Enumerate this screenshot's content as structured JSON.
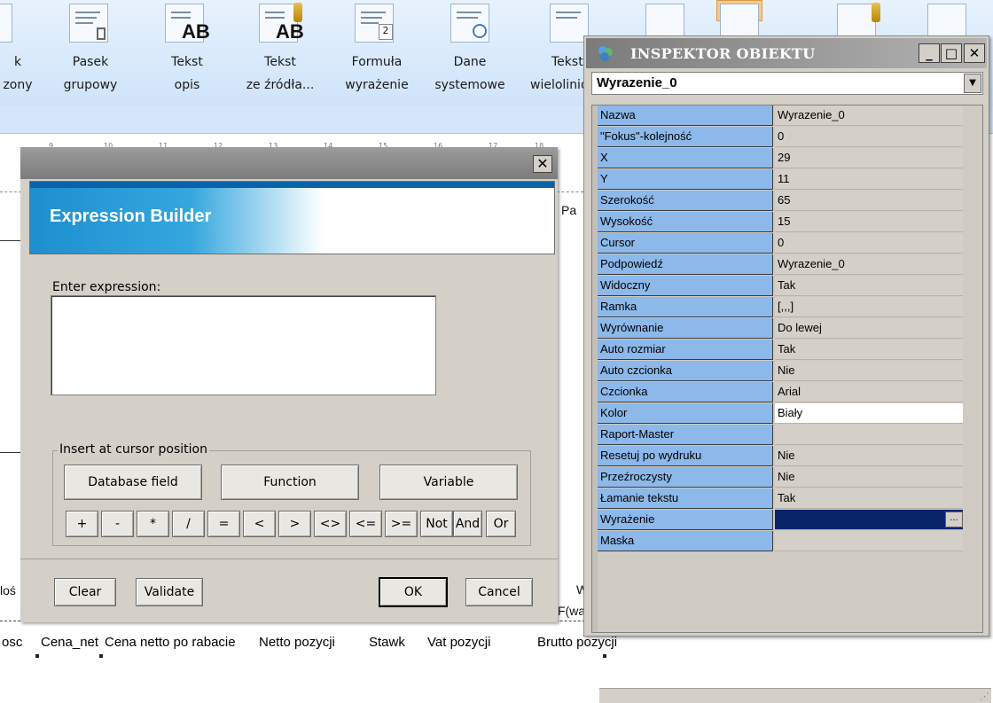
{
  "ribbon": {
    "items": [
      {
        "line1": "k",
        "line2": "zony"
      },
      {
        "line1": "Pasek",
        "line2": "grupowy"
      },
      {
        "line1": "Tekst",
        "line2": "opis"
      },
      {
        "line1": "Tekst",
        "line2": "ze źródła..."
      },
      {
        "line1": "Formuła",
        "line2": "wyrażenie"
      },
      {
        "line1": "Dane",
        "line2": "systemowe"
      },
      {
        "line1": "Tekst",
        "line2": "wielolinio"
      }
    ],
    "icon_text_ab": "AB",
    "icon_text_formula": "2"
  },
  "report": {
    "ruler": [
      "9",
      "10",
      "11",
      "12",
      "13",
      "14",
      "15",
      "16",
      "17",
      "18"
    ],
    "page_text": "Pa",
    "left_text": "loś",
    "w_text": "W",
    "fwa_text": "F(wa",
    "columns": [
      "osc",
      "Cena_net",
      "Cena netto po rabacie",
      "Netto pozycji",
      "Stawk",
      "Vat pozycji",
      "Brutto pozycji"
    ]
  },
  "expression_builder": {
    "close_glyph": "✕",
    "title": "Expression Builder",
    "enter_label": "Enter expression:",
    "expression_value": "",
    "insert_group_label": "Insert at cursor position",
    "database_field_label": "Database field",
    "function_label": "Function",
    "variable_label": "Variable",
    "operators": [
      "+",
      "-",
      "*",
      "/",
      "=",
      "<",
      ">",
      "<>",
      "<=",
      ">=",
      "Not",
      "And",
      "Or"
    ],
    "clear_label": "Clear",
    "validate_label": "Validate",
    "ok_label": "OK",
    "cancel_label": "Cancel"
  },
  "inspector": {
    "title": "INSPEKTOR OBIEKTU",
    "minimize_glyph": "_",
    "maximize_glyph": "□",
    "close_glyph": "✕",
    "selected_object": "Wyrazenie_0",
    "dropdown_glyph": "▼",
    "dots_label": "...",
    "properties": [
      {
        "key": "Nazwa",
        "value": "Wyrazenie_0"
      },
      {
        "key": "\"Fokus\"-kolejność",
        "value": "0"
      },
      {
        "key": "X",
        "value": "29"
      },
      {
        "key": "Y",
        "value": "11"
      },
      {
        "key": "Szerokość",
        "value": "65"
      },
      {
        "key": "Wysokość",
        "value": "15"
      },
      {
        "key": "Cursor",
        "value": "0"
      },
      {
        "key": "Podpowiedź",
        "value": "Wyrazenie_0"
      },
      {
        "key": "Widoczny",
        "value": "Tak"
      },
      {
        "key": "Ramka",
        "value": "[,,,]"
      },
      {
        "key": "Wyrównanie",
        "value": "Do lewej"
      },
      {
        "key": "Auto rozmiar",
        "value": "Tak"
      },
      {
        "key": "Auto czcionka",
        "value": "Nie"
      },
      {
        "key": "Czcionka",
        "value": "Arial"
      },
      {
        "key": "Kolor",
        "value": "Biały"
      },
      {
        "key": "Raport-Master",
        "value": ""
      },
      {
        "key": "Resetuj po wydruku",
        "value": "Nie"
      },
      {
        "key": "Przeźroczysty",
        "value": "Nie"
      },
      {
        "key": "Łamanie tekstu",
        "value": "Tak"
      },
      {
        "key": "Wyrażenie",
        "value": ""
      },
      {
        "key": "Maska",
        "value": ""
      }
    ]
  },
  "colors": {
    "ribbon_bg": "#d8e9fb",
    "inspector_key_bg": "#8cb8ea",
    "selected_value_bg": "#0a246a",
    "banner_blue": "#1d8fcf"
  }
}
